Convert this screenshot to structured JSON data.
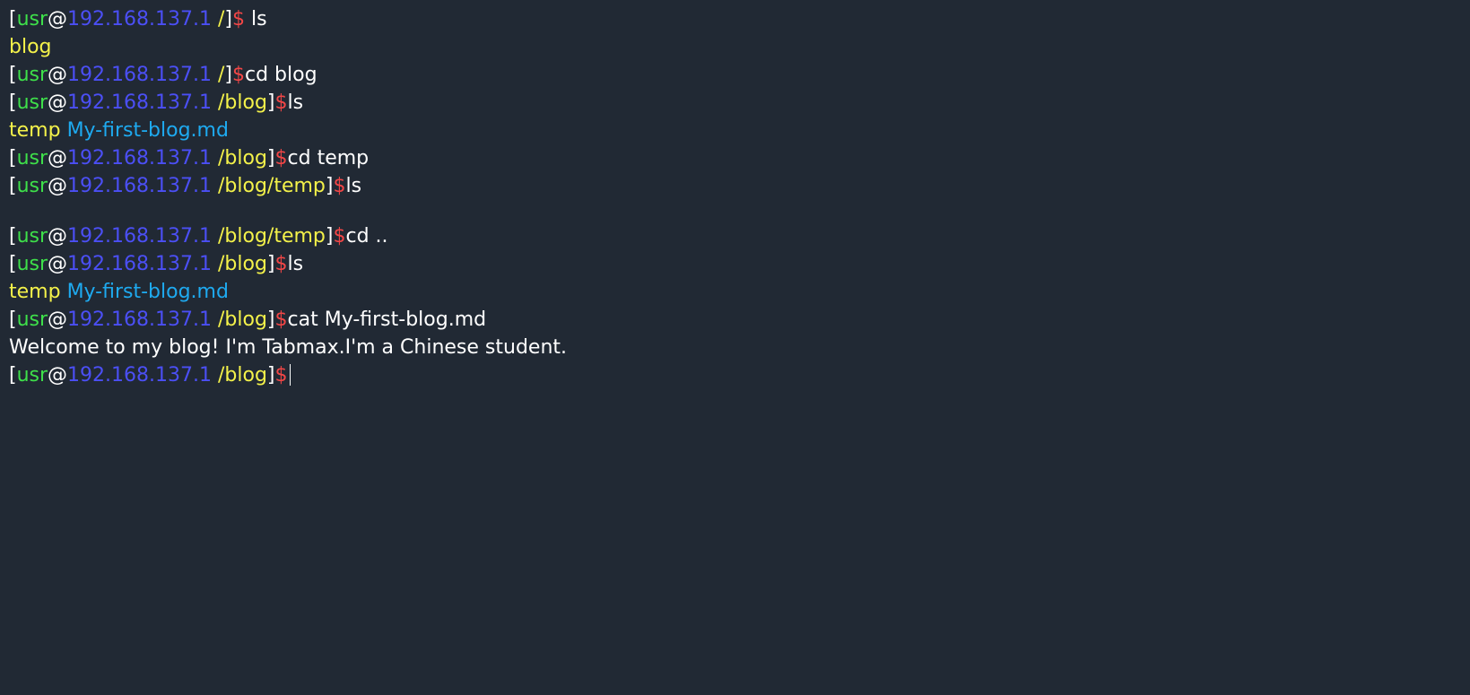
{
  "colors": {
    "background": "#212934",
    "bracket": "#ffffff",
    "user": "#3ee04a",
    "at": "#ffffff",
    "host": "#4b4ff5",
    "path": "#f4f24a",
    "dollar": "#f24646",
    "command": "#ffffff",
    "output_dir": "#f4f24a",
    "output_file": "#1eaaf0",
    "output_text": "#ffffff"
  },
  "terminal": {
    "lines": [
      {
        "type": "prompt",
        "segments": [
          {
            "text": "[",
            "role": "bracket"
          },
          {
            "text": "usr",
            "role": "user"
          },
          {
            "text": "@",
            "role": "at"
          },
          {
            "text": "192.168.137.1",
            "role": "host"
          },
          {
            "text": " /",
            "role": "path"
          },
          {
            "text": "]",
            "role": "bracket"
          },
          {
            "text": "$",
            "role": "dollar"
          },
          {
            "text": " ls",
            "role": "command"
          }
        ]
      },
      {
        "type": "output",
        "segments": [
          {
            "text": "blog",
            "role": "output_dir"
          }
        ]
      },
      {
        "type": "prompt",
        "segments": [
          {
            "text": "[",
            "role": "bracket"
          },
          {
            "text": "usr",
            "role": "user"
          },
          {
            "text": "@",
            "role": "at"
          },
          {
            "text": "192.168.137.1",
            "role": "host"
          },
          {
            "text": " /",
            "role": "path"
          },
          {
            "text": "]",
            "role": "bracket"
          },
          {
            "text": "$",
            "role": "dollar"
          },
          {
            "text": "cd blog",
            "role": "command"
          }
        ]
      },
      {
        "type": "prompt",
        "segments": [
          {
            "text": "[",
            "role": "bracket"
          },
          {
            "text": "usr",
            "role": "user"
          },
          {
            "text": "@",
            "role": "at"
          },
          {
            "text": "192.168.137.1",
            "role": "host"
          },
          {
            "text": " /blog",
            "role": "path"
          },
          {
            "text": "]",
            "role": "bracket"
          },
          {
            "text": "$",
            "role": "dollar"
          },
          {
            "text": "ls",
            "role": "command"
          }
        ]
      },
      {
        "type": "output",
        "segments": [
          {
            "text": "temp",
            "role": "output_dir"
          },
          {
            "text": " ",
            "role": "output_text"
          },
          {
            "text": "My-first-blog.md",
            "role": "output_file"
          }
        ]
      },
      {
        "type": "prompt",
        "segments": [
          {
            "text": "[",
            "role": "bracket"
          },
          {
            "text": "usr",
            "role": "user"
          },
          {
            "text": "@",
            "role": "at"
          },
          {
            "text": "192.168.137.1",
            "role": "host"
          },
          {
            "text": " /blog",
            "role": "path"
          },
          {
            "text": "]",
            "role": "bracket"
          },
          {
            "text": "$",
            "role": "dollar"
          },
          {
            "text": "cd temp",
            "role": "command"
          }
        ]
      },
      {
        "type": "prompt",
        "segments": [
          {
            "text": "[",
            "role": "bracket"
          },
          {
            "text": "usr",
            "role": "user"
          },
          {
            "text": "@",
            "role": "at"
          },
          {
            "text": "192.168.137.1",
            "role": "host"
          },
          {
            "text": " /blog/temp",
            "role": "path"
          },
          {
            "text": "]",
            "role": "bracket"
          },
          {
            "text": "$",
            "role": "dollar"
          },
          {
            "text": "ls",
            "role": "command"
          }
        ]
      },
      {
        "type": "blank",
        "segments": []
      },
      {
        "type": "prompt",
        "segments": [
          {
            "text": "[",
            "role": "bracket"
          },
          {
            "text": "usr",
            "role": "user"
          },
          {
            "text": "@",
            "role": "at"
          },
          {
            "text": "192.168.137.1",
            "role": "host"
          },
          {
            "text": " /blog/temp",
            "role": "path"
          },
          {
            "text": "]",
            "role": "bracket"
          },
          {
            "text": "$",
            "role": "dollar"
          },
          {
            "text": "cd ..",
            "role": "command"
          }
        ]
      },
      {
        "type": "prompt",
        "segments": [
          {
            "text": "[",
            "role": "bracket"
          },
          {
            "text": "usr",
            "role": "user"
          },
          {
            "text": "@",
            "role": "at"
          },
          {
            "text": "192.168.137.1",
            "role": "host"
          },
          {
            "text": " /blog",
            "role": "path"
          },
          {
            "text": "]",
            "role": "bracket"
          },
          {
            "text": "$",
            "role": "dollar"
          },
          {
            "text": "ls",
            "role": "command"
          }
        ]
      },
      {
        "type": "output",
        "segments": [
          {
            "text": "temp",
            "role": "output_dir"
          },
          {
            "text": " ",
            "role": "output_text"
          },
          {
            "text": "My-first-blog.md",
            "role": "output_file"
          }
        ]
      },
      {
        "type": "prompt",
        "segments": [
          {
            "text": "[",
            "role": "bracket"
          },
          {
            "text": "usr",
            "role": "user"
          },
          {
            "text": "@",
            "role": "at"
          },
          {
            "text": "192.168.137.1",
            "role": "host"
          },
          {
            "text": " /blog",
            "role": "path"
          },
          {
            "text": "]",
            "role": "bracket"
          },
          {
            "text": "$",
            "role": "dollar"
          },
          {
            "text": "cat My-first-blog.md",
            "role": "command"
          }
        ]
      },
      {
        "type": "output",
        "segments": [
          {
            "text": "Welcome to my blog! I'm Tabmax.I'm a Chinese student.",
            "role": "output_text"
          }
        ]
      },
      {
        "type": "input",
        "segments": [
          {
            "text": "[",
            "role": "bracket"
          },
          {
            "text": "usr",
            "role": "user"
          },
          {
            "text": "@",
            "role": "at"
          },
          {
            "text": "192.168.137.1",
            "role": "host"
          },
          {
            "text": " /blog",
            "role": "path"
          },
          {
            "text": "]",
            "role": "bracket"
          },
          {
            "text": "$",
            "role": "dollar"
          },
          {
            "text": "",
            "role": "command"
          }
        ]
      }
    ]
  }
}
